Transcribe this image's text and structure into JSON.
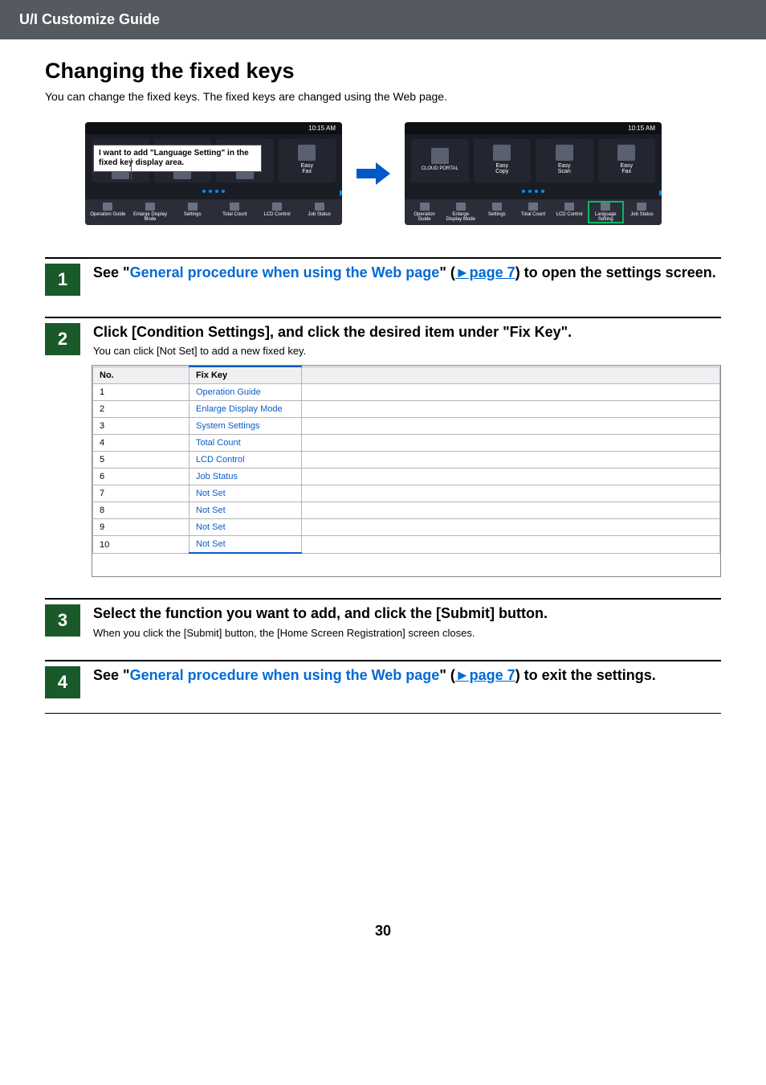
{
  "header": {
    "title": "U/I Customize Guide"
  },
  "page": {
    "title": "Changing the fixed keys",
    "intro": "You can change the fixed keys. The fixed keys are changed using the Web page.",
    "number": "30"
  },
  "diagram": {
    "time": "10:15 AM",
    "bubble": "I want to add \"Language Setting\" in the fixed key display area.",
    "left_panel": {
      "slots": [
        "",
        "",
        "",
        "Easy\nFax"
      ],
      "bottom": [
        "Operation Guide",
        "Enlarge Display Mode",
        "Settings",
        "Total Count",
        "LCD Control",
        "Job Status"
      ]
    },
    "right_panel": {
      "slots": [
        "CLOUD PORTAL",
        "Easy Copy",
        "Easy Scan",
        "Easy Fax"
      ],
      "bottom": [
        "Operation Guide",
        "Enlarge Display Mode",
        "Settings",
        "Total Count",
        "LCD Control",
        "Language Setting",
        "Job Status"
      ]
    }
  },
  "steps": {
    "s1": {
      "num": "1",
      "pre": "See \"",
      "link": "General procedure when using the Web page",
      "mid": "\" (",
      "plink": "►page 7",
      "post": ") to open the settings screen."
    },
    "s2": {
      "num": "2",
      "title": "Click [Condition Settings], and click the desired item under \"Fix Key\".",
      "sub": "You can click [Not Set] to add a new fixed key."
    },
    "s3": {
      "num": "3",
      "title": "Select the function you want to add, and click the [Submit] button.",
      "sub": "When you click the [Submit] button, the [Home Screen Registration] screen closes."
    },
    "s4": {
      "num": "4",
      "pre": "See \"",
      "link": "General procedure when using the Web page",
      "mid": "\" (",
      "plink": "►page 7",
      "post": ") to exit the settings."
    }
  },
  "table": {
    "head_no": "No.",
    "head_fix": "Fix Key",
    "rows": [
      {
        "n": "1",
        "v": "Operation Guide"
      },
      {
        "n": "2",
        "v": "Enlarge Display Mode"
      },
      {
        "n": "3",
        "v": "System Settings"
      },
      {
        "n": "4",
        "v": "Total Count"
      },
      {
        "n": "5",
        "v": "LCD Control"
      },
      {
        "n": "6",
        "v": "Job Status"
      },
      {
        "n": "7",
        "v": "Not Set"
      },
      {
        "n": "8",
        "v": "Not Set"
      },
      {
        "n": "9",
        "v": "Not Set"
      },
      {
        "n": "10",
        "v": "Not Set"
      }
    ]
  }
}
